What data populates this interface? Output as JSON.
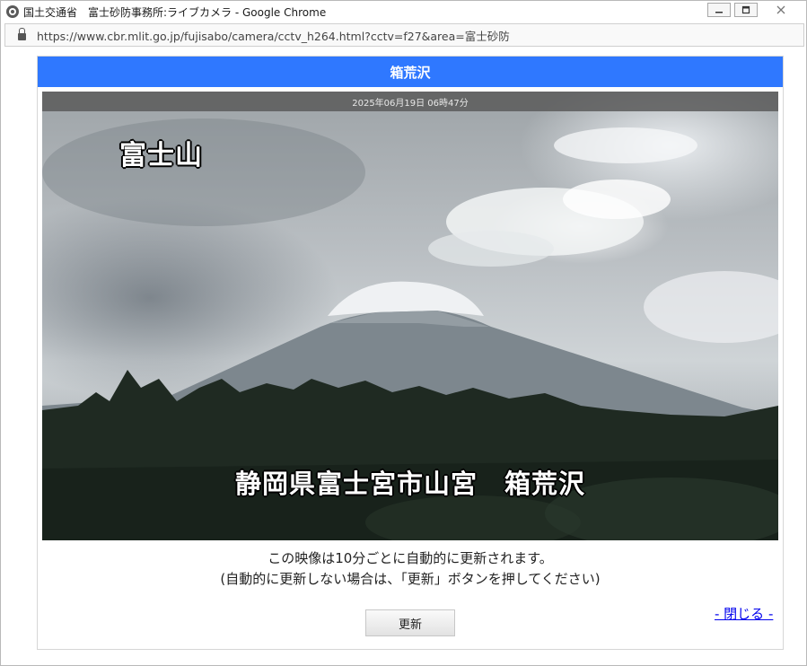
{
  "window": {
    "title": "国土交通省　富士砂防事務所:ライブカメラ - Google Chrome",
    "controls": [
      "minimize-icon",
      "maximize-icon",
      "close-icon"
    ]
  },
  "addressbar": {
    "url": "https://www.cbr.mlit.go.jp/fujisabo/camera/cctv_h264.html?cctv=f27&area=富士砂防"
  },
  "popup": {
    "header_title": "箱荒沢",
    "camera": {
      "timestamp": "2025年06月19日 06時47分",
      "overlay_top_label": "富士山",
      "overlay_bottom_label": "静岡県富士宮市山宮　箱荒沢"
    },
    "notice_line1": "この映像は10分ごとに自動的に更新されます。",
    "notice_line2": "(自動的に更新しない場合は、「更新」ボタンを押してください)",
    "refresh_label": "更新",
    "close_label": "- 閉じる -"
  },
  "colors": {
    "header_bg": "#2f78ff",
    "link": "#0000ee"
  }
}
